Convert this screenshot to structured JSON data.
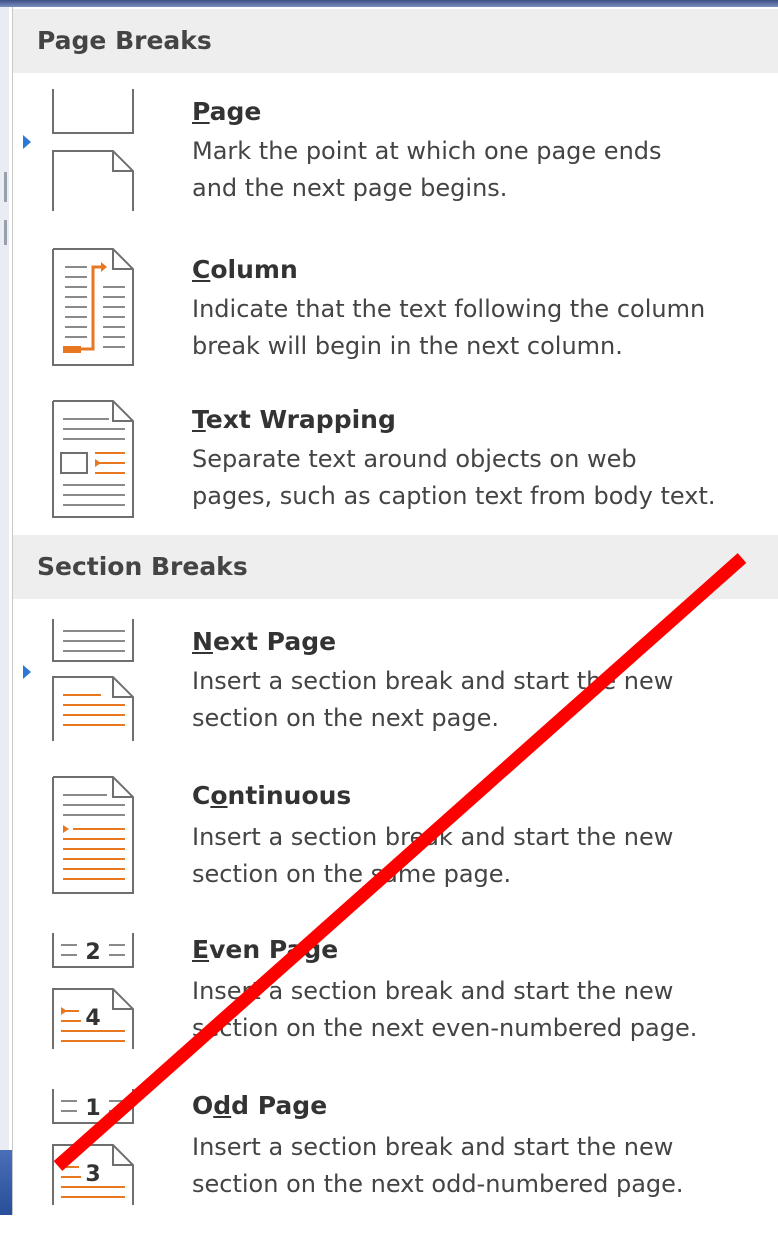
{
  "sections": {
    "page_breaks": "Page Breaks",
    "section_breaks": "Section Breaks"
  },
  "items": {
    "page": {
      "pre": "",
      "key": "P",
      "post": "age",
      "line1": "Mark the point at which one page ends",
      "line2": "and the next page begins."
    },
    "column": {
      "pre": "",
      "key": "C",
      "post": "olumn",
      "line1": "Indicate that the text following the column",
      "line2": "break will begin in the next column."
    },
    "text_wrapping": {
      "pre": "",
      "key": "T",
      "post": "ext Wrapping",
      "line1": "Separate text around objects on web",
      "line2": "pages, such as caption text from body text."
    },
    "next_page": {
      "pre": "",
      "key": "N",
      "post": "ext Page",
      "line1": "Insert a section break and start the new",
      "line2": "section on the next page."
    },
    "continuous": {
      "pre": "C",
      "key": "o",
      "post": "ntinuous",
      "line1": "Insert a section break and start the new",
      "line2": "section on the same page."
    },
    "even_page": {
      "pre": "",
      "key": "E",
      "post": "ven Page",
      "line1": "Insert a section break and start the new",
      "line2": "section on the next even-numbered page."
    },
    "odd_page": {
      "pre": "O",
      "key": "d",
      "post": "d Page",
      "line1": "Insert a section break and start the new",
      "line2": "section on the next odd-numbered page."
    }
  },
  "icon_numbers": {
    "even_top": "2",
    "even_bottom": "4",
    "odd_top": "1",
    "odd_bottom": "3"
  },
  "colors": {
    "accent_orange": "#e87722",
    "strike_red": "#ff0000",
    "header_bg": "#eeeeee",
    "pointer_blue": "#2b78d8"
  },
  "icons": {
    "page": "page-break-icon",
    "column": "column-break-icon",
    "text_wrapping": "text-wrapping-break-icon",
    "next_page": "next-page-section-break-icon",
    "continuous": "continuous-section-break-icon",
    "even_page": "even-page-section-break-icon",
    "odd_page": "odd-page-section-break-icon"
  }
}
